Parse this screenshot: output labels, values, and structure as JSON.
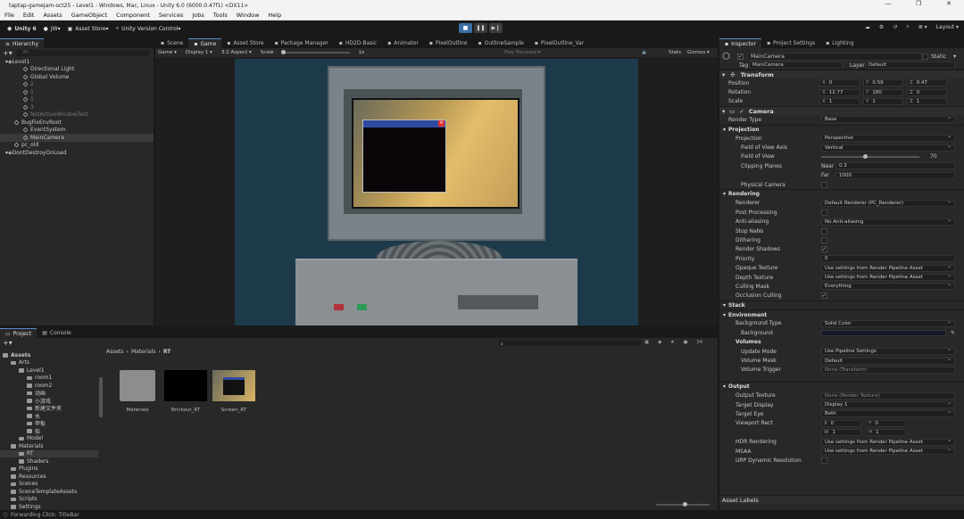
{
  "window": {
    "title": "taptap-gamejam-oct25 - Level1 - Windows, Mac, Linux - Unity 6.0 (6000.0.47f1) <DX11>",
    "controls": [
      "—",
      "❐",
      "✕"
    ]
  },
  "menu": [
    "File",
    "Edit",
    "Assets",
    "GameObject",
    "Component",
    "Services",
    "Jobs",
    "Tools",
    "Window",
    "Help"
  ],
  "toolbar": {
    "unity": "Unity 6",
    "account": "JW",
    "asset_store": "Asset Store",
    "version_control": "Unity Version Control",
    "layout": "Layout"
  },
  "hierarchy": {
    "tab": "Hierarchy",
    "search_placeholder": "All",
    "items": [
      {
        "label": "Level1",
        "indent": 0,
        "icon": "scene",
        "dim": false,
        "sel": false
      },
      {
        "label": "Directional Light",
        "indent": 2,
        "icon": "cube",
        "dim": false,
        "sel": false
      },
      {
        "label": "Global Volume",
        "indent": 2,
        "icon": "cube",
        "dim": false,
        "sel": false
      },
      {
        "label": "2",
        "indent": 2,
        "icon": "cube",
        "dim": true,
        "sel": false
      },
      {
        "label": "1",
        "indent": 2,
        "icon": "cube",
        "dim": true,
        "sel": false
      },
      {
        "label": "1",
        "indent": 2,
        "icon": "cube",
        "dim": true,
        "sel": false
      },
      {
        "label": "3",
        "indent": 2,
        "icon": "cube",
        "dim": true,
        "sel": false
      },
      {
        "label": "NotActiveWindowTest",
        "indent": 2,
        "icon": "cube",
        "dim": true,
        "sel": false
      },
      {
        "label": "BugFixEnvRoot",
        "indent": 1,
        "icon": "cube",
        "dim": false,
        "sel": false
      },
      {
        "label": "EventSystem",
        "indent": 2,
        "icon": "cube",
        "dim": false,
        "sel": false
      },
      {
        "label": "MainCamera",
        "indent": 2,
        "icon": "cube",
        "dim": false,
        "sel": true
      },
      {
        "label": "pc_old",
        "indent": 1,
        "icon": "cube",
        "dim": false,
        "sel": false
      },
      {
        "label": "DontDestroyOnLoad",
        "indent": 0,
        "icon": "scene",
        "dim": false,
        "sel": false
      }
    ]
  },
  "center_tabs": [
    "Scene",
    "Game",
    "Asset Store",
    "Package Manager",
    "HD2D-Basic",
    "Animator",
    "PixelOutline",
    "OutlineSample",
    "PixelOutline_Var"
  ],
  "game_bar": {
    "mode": "Game",
    "display": "Display 1",
    "aspect": "3:2 Aspect",
    "scale_label": "Scale",
    "scale_value": "1x",
    "play_focused": "Play Focused",
    "stats": "Stats",
    "gizmos": "Gizmos"
  },
  "project": {
    "tabs": [
      "Project",
      "Console"
    ],
    "tree": [
      {
        "label": "Assets",
        "indent": 0,
        "bold": true
      },
      {
        "label": "Arts",
        "indent": 1
      },
      {
        "label": "Level1",
        "indent": 2
      },
      {
        "label": "room1",
        "indent": 3
      },
      {
        "label": "room2",
        "indent": 3
      },
      {
        "label": "动画",
        "indent": 3
      },
      {
        "label": "小游戏",
        "indent": 3
      },
      {
        "label": "新建文件夹",
        "indent": 3
      },
      {
        "label": "水",
        "indent": 3
      },
      {
        "label": "甲板",
        "indent": 3
      },
      {
        "label": "船",
        "indent": 3
      },
      {
        "label": "Model",
        "indent": 2
      },
      {
        "label": "Materials",
        "indent": 1
      },
      {
        "label": "RT",
        "indent": 2,
        "sel": true
      },
      {
        "label": "Shaders",
        "indent": 2
      },
      {
        "label": "Plugins",
        "indent": 1
      },
      {
        "label": "Resources",
        "indent": 1
      },
      {
        "label": "Scenes",
        "indent": 1
      },
      {
        "label": "SceneTemplateAssets",
        "indent": 1
      },
      {
        "label": "Scripts",
        "indent": 1
      },
      {
        "label": "Settings",
        "indent": 1
      }
    ],
    "breadcrumb": [
      "Assets",
      "Materials",
      "RT"
    ],
    "count": "34",
    "assets": [
      {
        "label": "Materials",
        "kind": "folder"
      },
      {
        "label": "Brickout_RT",
        "kind": "black"
      },
      {
        "label": "Screen_RT",
        "kind": "screen"
      }
    ]
  },
  "inspector": {
    "tabs": [
      "Inspector",
      "Project Settings",
      "Lighting"
    ],
    "object_name": "MainCamera",
    "static": "Static",
    "tag_label": "Tag",
    "tag": "MainCamera",
    "layer_label": "Layer",
    "layer": "Default",
    "transform": {
      "title": "Transform",
      "position": {
        "label": "Position",
        "x": "0",
        "y": "0.59",
        "z": "0.47"
      },
      "rotation": {
        "label": "Rotation",
        "x": "12.77",
        "y": "180",
        "z": "0"
      },
      "scale": {
        "label": "Scale",
        "x": "1",
        "y": "1",
        "z": "1"
      }
    },
    "camera": {
      "title": "Camera",
      "render_type_label": "Render Type",
      "render_type": "Base"
    },
    "rows": [
      {
        "kind": "sub",
        "label": "Projection"
      },
      {
        "kind": "dd",
        "label": "Projection",
        "value": "Perspective",
        "ind": 2
      },
      {
        "kind": "dd",
        "label": "Field of View Axis",
        "value": "Vertical",
        "ind": 3
      },
      {
        "kind": "slider",
        "label": "Field of View",
        "value": "70",
        "ind": 3
      },
      {
        "kind": "nearfar",
        "label": "Clipping Planes",
        "near_label": "Near",
        "near": "0.3",
        "ind": 3
      },
      {
        "kind": "far",
        "far_label": "Far",
        "far": "1000"
      },
      {
        "kind": "chk",
        "label": "Physical Camera",
        "checked": false,
        "ind": 3
      },
      {
        "kind": "sub",
        "label": "Rendering"
      },
      {
        "kind": "dd",
        "label": "Renderer",
        "value": "Default Renderer (PC_Renderer)",
        "ind": 2
      },
      {
        "kind": "chk",
        "label": "Post Processing",
        "checked": false,
        "ind": 2
      },
      {
        "kind": "dd",
        "label": "Anti-aliasing",
        "value": "No Anti-aliasing",
        "ind": 2
      },
      {
        "kind": "chk",
        "label": "Stop NaNs",
        "checked": false,
        "ind": 2
      },
      {
        "kind": "chk",
        "label": "Dithering",
        "checked": false,
        "ind": 2
      },
      {
        "kind": "chk",
        "label": "Render Shadows",
        "checked": true,
        "ind": 2
      },
      {
        "kind": "text",
        "label": "Priority",
        "value": "0",
        "ind": 2
      },
      {
        "kind": "dd",
        "label": "Opaque Texture",
        "value": "Use settings from Render Pipeline Asset",
        "ind": 2
      },
      {
        "kind": "dd",
        "label": "Depth Texture",
        "value": "Use settings from Render Pipeline Asset",
        "ind": 2
      },
      {
        "kind": "dd",
        "label": "Culling Mask",
        "value": "Everything",
        "ind": 2
      },
      {
        "kind": "chk",
        "label": "Occlusion Culling",
        "checked": true,
        "ind": 2
      },
      {
        "kind": "sub",
        "label": "Stack"
      },
      {
        "kind": "sub",
        "label": "Environment"
      },
      {
        "kind": "dd",
        "label": "Background Type",
        "value": "Solid Color",
        "ind": 2
      },
      {
        "kind": "color",
        "label": "Background",
        "ind": 3
      },
      {
        "kind": "sub2",
        "label": "Volumes"
      },
      {
        "kind": "dd",
        "label": "Update Mode",
        "value": "Use Pipeline Settings",
        "ind": 3
      },
      {
        "kind": "dd",
        "label": "Volume Mask",
        "value": "Default",
        "ind": 3
      },
      {
        "kind": "text",
        "label": "Volume Trigger",
        "value": "None (Transform)",
        "ind": 3
      },
      {
        "kind": "gap"
      },
      {
        "kind": "sub",
        "label": "Output"
      },
      {
        "kind": "text",
        "label": "Output Texture",
        "value": "None (Render Texture)",
        "ind": 2
      },
      {
        "kind": "dd",
        "label": "Target Display",
        "value": "Display 1",
        "ind": 2
      },
      {
        "kind": "dd",
        "label": "Target Eye",
        "value": "Both",
        "ind": 2
      },
      {
        "kind": "xy",
        "label": "Viewport Rect",
        "x": "0",
        "y": "0",
        "ind": 2
      },
      {
        "kind": "wh",
        "w": "1",
        "h": "1"
      },
      {
        "kind": "dd",
        "label": "HDR Rendering",
        "value": "Use settings from Render Pipeline Asset",
        "ind": 2
      },
      {
        "kind": "dd",
        "label": "MSAA",
        "value": "Use settings from Render Pipeline Asset",
        "ind": 2
      },
      {
        "kind": "chk",
        "label": "URP Dynamic Resolution",
        "checked": false,
        "ind": 2
      }
    ],
    "asset_labels": "Asset Labels"
  },
  "status": "Forwarding Click: TitleBar",
  "colors": {
    "accent": "#3a6ea5",
    "bg_color_swatch": "#141a2c"
  }
}
